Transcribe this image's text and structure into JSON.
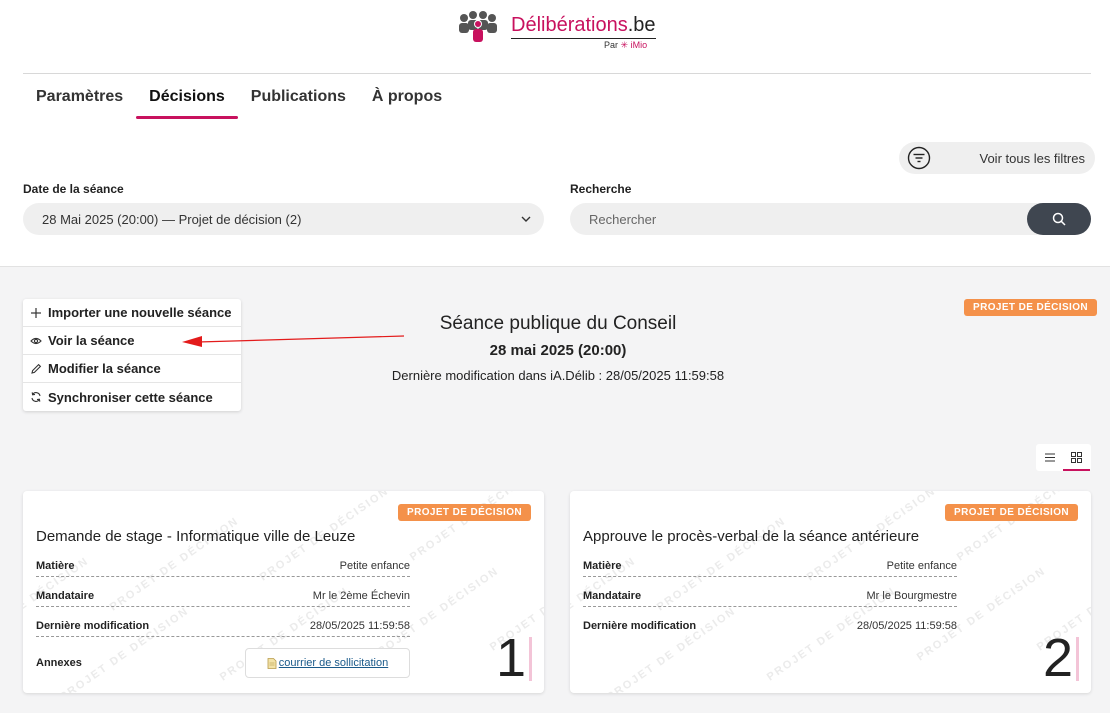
{
  "app": {
    "title_main": "Délibérations",
    "title_tld": ".be",
    "by_prefix": "Par",
    "by_brand": "iMio"
  },
  "nav": {
    "tabs": [
      {
        "label": "Paramètres",
        "active": false
      },
      {
        "label": "Décisions",
        "active": true
      },
      {
        "label": "Publications",
        "active": false
      },
      {
        "label": "À propos",
        "active": false
      }
    ]
  },
  "filters": {
    "all_filters_label": "Voir tous les filtres",
    "date_label": "Date de la séance",
    "date_value": "28 Mai 2025 (20:00) — Projet de décision (2)",
    "search_label": "Recherche",
    "search_placeholder": "Rechercher"
  },
  "actions": [
    {
      "label": "Importer une nouvelle séance",
      "icon": "plus-icon"
    },
    {
      "label": "Voir la séance",
      "icon": "eye-icon"
    },
    {
      "label": "Modifier la séance",
      "icon": "pencil-icon"
    },
    {
      "label": "Synchroniser cette séance",
      "icon": "sync-icon"
    }
  ],
  "seance": {
    "title": "Séance publique du Conseil",
    "date": "28 mai 2025 (20:00)",
    "last_modified": "Dernière modification dans iA.Délib : 28/05/2025 11:59:58",
    "status_badge": "PROJET DE DÉCISION"
  },
  "watermark_text": "PROJET DE DÉCISION",
  "colors": {
    "brand": "#c8115e",
    "badge": "#f4914a",
    "search_button": "#3f4650"
  },
  "cards": [
    {
      "badge": "PROJET DE DÉCISION",
      "title": "Demande de stage - Informatique ville de Leuze",
      "matiere_label": "Matière",
      "matiere": "Petite enfance",
      "mandataire_label": "Mandataire",
      "mandataire": "Mr le 2ème Échevin",
      "modif_label": "Dernière modification",
      "modif": "28/05/2025 11:59:58",
      "annexes_label": "Annexes",
      "annex_link": "courrier de sollicitation",
      "number": "1"
    },
    {
      "badge": "PROJET DE DÉCISION",
      "title": "Approuve le procès-verbal de la séance antérieure",
      "matiere_label": "Matière",
      "matiere": "Petite enfance",
      "mandataire_label": "Mandataire",
      "mandataire": "Mr le Bourgmestre",
      "modif_label": "Dernière modification",
      "modif": "28/05/2025 11:59:58",
      "number": "2"
    }
  ]
}
